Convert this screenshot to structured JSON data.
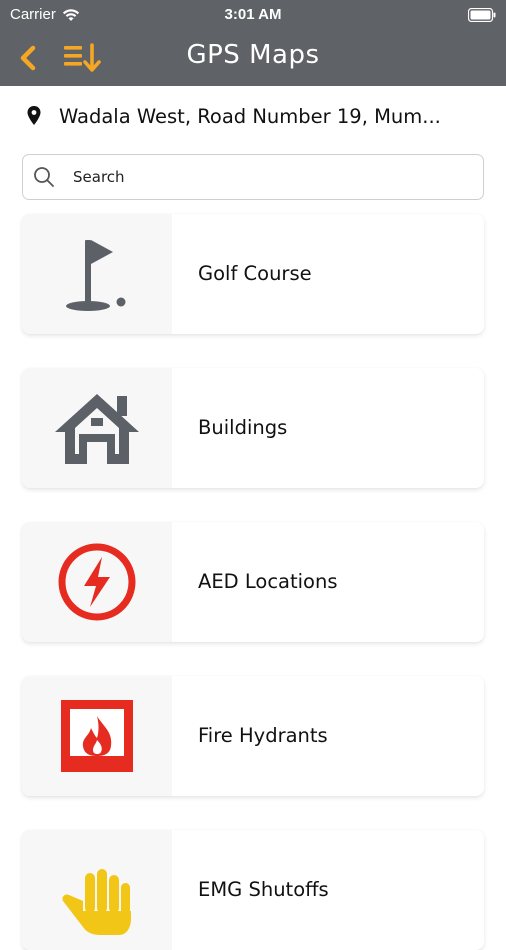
{
  "status_bar": {
    "carrier": "Carrier",
    "time": "3:01 AM"
  },
  "nav": {
    "title": "GPS Maps",
    "back_icon": "chevron-left-icon",
    "sort_icon": "sort-list-icon",
    "accent_color": "#f5a623",
    "bar_color": "#5f6266"
  },
  "location": {
    "icon": "map-pin-icon",
    "text": "Wadala West, Road Number 19, Mum..."
  },
  "search": {
    "placeholder": "Search"
  },
  "categories": [
    {
      "label": "Golf Course",
      "icon": "golf-flag-icon"
    },
    {
      "label": "Buildings",
      "icon": "house-icon"
    },
    {
      "label": "AED Locations",
      "icon": "aed-lightning-icon"
    },
    {
      "label": "Fire Hydrants",
      "icon": "fireplace-flame-icon"
    },
    {
      "label": "EMG Shutoffs",
      "icon": "stop-hand-icon"
    }
  ]
}
